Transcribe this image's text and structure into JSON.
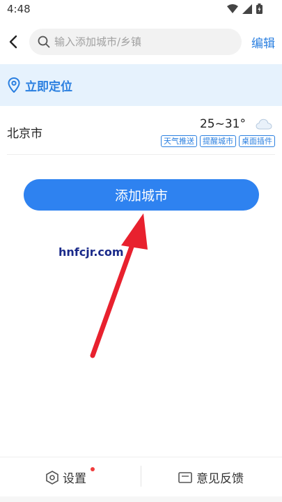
{
  "status_bar": {
    "time": "4:48",
    "icons": [
      "wifi-icon",
      "signal-icon",
      "battery-icon"
    ]
  },
  "search": {
    "placeholder": "输入添加城市/乡镇",
    "value": "",
    "edit_label": "编辑"
  },
  "locate": {
    "label": "立即定位"
  },
  "city": {
    "name": "北京市",
    "temperature": "25~31°",
    "weather_icon": "cloud-icon",
    "tags": [
      "天气推送",
      "提醒城市",
      "桌面插件"
    ]
  },
  "add_city": {
    "label": "添加城市"
  },
  "watermark": {
    "text": "hnfcjr.com"
  },
  "bottom_nav": {
    "settings_label": "设置",
    "feedback_label": "意见反馈"
  },
  "colors": {
    "accent": "#2e82f0",
    "locate_bg": "#e6f2fd",
    "arrow": "#e8212e",
    "badge": "#f03c3c"
  }
}
